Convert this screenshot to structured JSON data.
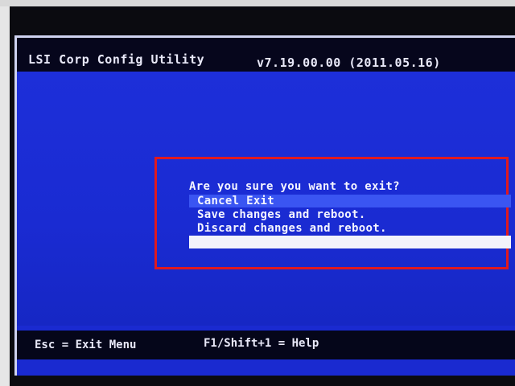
{
  "window": {
    "title": "LSI Corp Config Utility",
    "version": "v7.19.00.00 (2011.05.16)"
  },
  "dialog": {
    "question": "Are you sure you want to exit?",
    "options": [
      {
        "label": "Cancel Exit",
        "selected": true
      },
      {
        "label": "Save changes and reboot.",
        "selected": false
      },
      {
        "label": "Discard changes and reboot.",
        "selected": false
      }
    ],
    "frame_color": "#e0191f"
  },
  "status_bar": {
    "exit_hint": "Esc = Exit Menu",
    "help_hint": "F1/Shift+1 = Help"
  },
  "colors": {
    "screen_background": "#1a2ad0",
    "bar_background": "#06061c",
    "text": "#f4f4ff"
  }
}
